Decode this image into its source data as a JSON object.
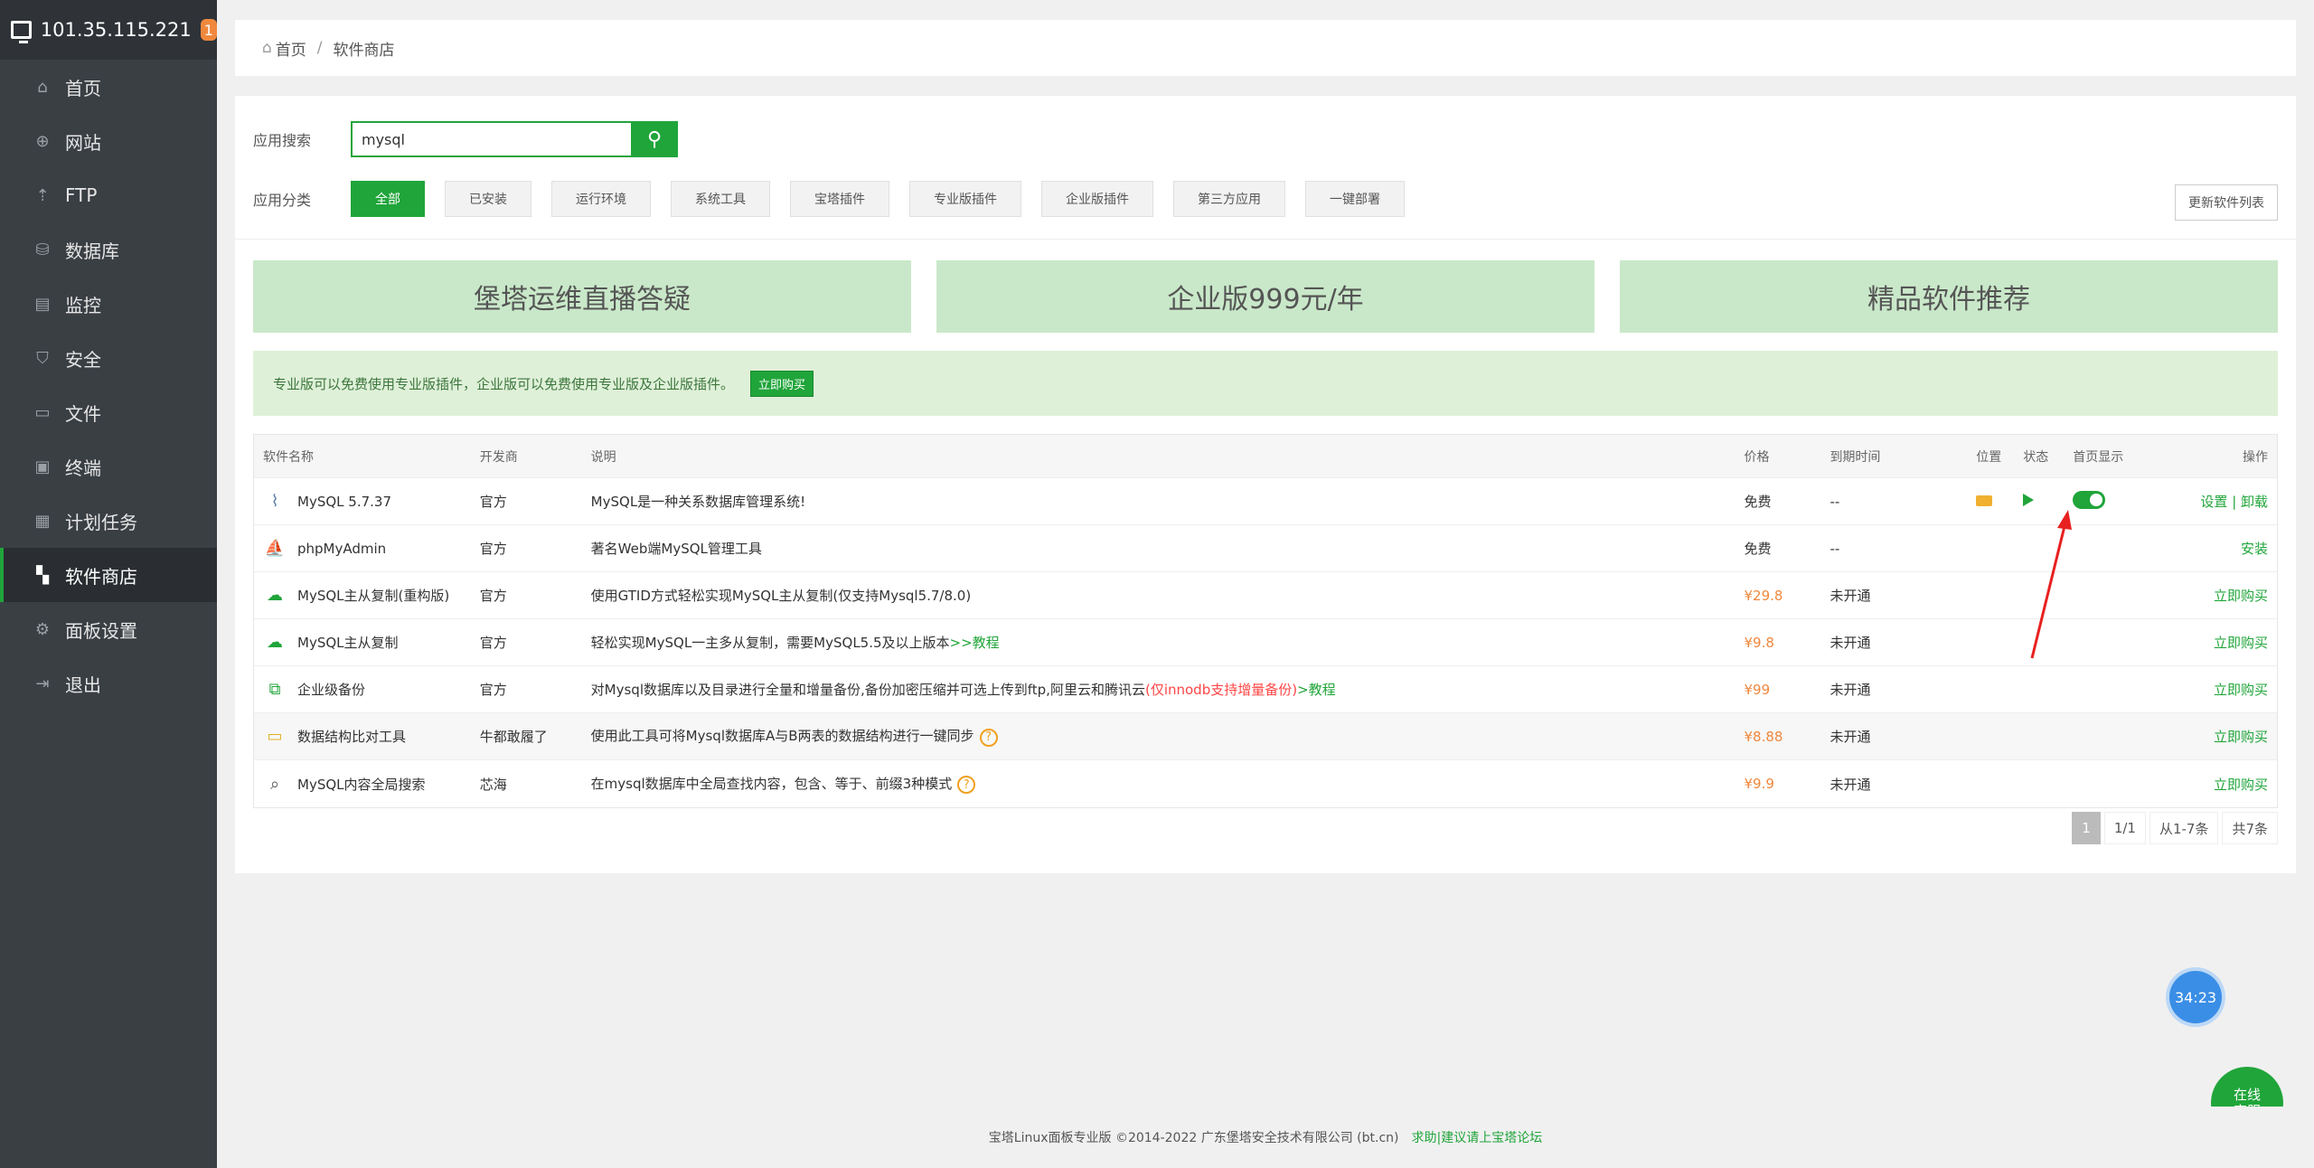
{
  "sidebar": {
    "server_ip": "101.35.115.221",
    "badge": "1",
    "items": [
      {
        "label": "首页",
        "icon": "home-icon",
        "glyph": "⌂"
      },
      {
        "label": "网站",
        "icon": "globe-icon",
        "glyph": "⊕"
      },
      {
        "label": "FTP",
        "icon": "ftp-icon",
        "glyph": "⇡"
      },
      {
        "label": "数据库",
        "icon": "database-icon",
        "glyph": "⛁"
      },
      {
        "label": "监控",
        "icon": "monitor-icon",
        "glyph": "▤"
      },
      {
        "label": "安全",
        "icon": "shield-icon",
        "glyph": "⛉"
      },
      {
        "label": "文件",
        "icon": "folder-icon",
        "glyph": "▭"
      },
      {
        "label": "终端",
        "icon": "terminal-icon",
        "glyph": "▣"
      },
      {
        "label": "计划任务",
        "icon": "calendar-icon",
        "glyph": "▦"
      },
      {
        "label": "软件商店",
        "icon": "grid-icon",
        "glyph": "▚"
      },
      {
        "label": "面板设置",
        "icon": "gear-icon",
        "glyph": "⚙"
      },
      {
        "label": "退出",
        "icon": "logout-icon",
        "glyph": "⇥"
      }
    ]
  },
  "breadcrumb": {
    "home": "首页",
    "sep": "/",
    "current": "软件商店"
  },
  "search": {
    "label": "应用搜索",
    "value": "mysql"
  },
  "categories": {
    "label": "应用分类",
    "items": [
      "全部",
      "已安装",
      "运行环境",
      "系统工具",
      "宝塔插件",
      "专业版插件",
      "企业版插件",
      "第三方应用",
      "一键部署"
    ]
  },
  "update_button": "更新软件列表",
  "banners": [
    "堡塔运维直播答疑",
    "企业版999元/年",
    "精品软件推荐"
  ],
  "notice": {
    "text": "专业版可以免费使用专业版插件，企业版可以免费使用专业版及企业版插件。",
    "buy": "立即购买"
  },
  "table": {
    "headers": [
      "软件名称",
      "开发商",
      "说明",
      "价格",
      "到期时间",
      "位置",
      "状态",
      "首页显示",
      "操作"
    ],
    "rows": [
      {
        "name": "MySQL 5.7.37",
        "dev": "官方",
        "desc": "MySQL是一种关系数据库管理系统!",
        "price": "免费",
        "expire": "--",
        "op": "设置 | 卸载"
      },
      {
        "name": "phpMyAdmin",
        "dev": "官方",
        "desc": "著名Web端MySQL管理工具",
        "price": "免费",
        "expire": "--",
        "op": "安装"
      },
      {
        "name": "MySQL主从复制(重构版)",
        "dev": "官方",
        "desc": "使用GTID方式轻松实现MySQL主从复制(仅支持Mysql5.7/8.0)",
        "price": "¥29.8",
        "expire": "未开通",
        "op": "立即购买"
      },
      {
        "name": "MySQL主从复制",
        "dev": "官方",
        "desc": "轻松实现MySQL一主多从复制，需要MySQL5.5及以上版本",
        "link": ">>教程",
        "price": "¥9.8",
        "expire": "未开通",
        "op": "立即购买"
      },
      {
        "name": "企业级备份",
        "dev": "官方",
        "desc": "对Mysql数据库以及目录进行全量和增量备份,备份加密压缩并可选上传到ftp,阿里云和腾讯云",
        "desc_red": "(仅innodb支持增量备份)",
        "link": ">教程",
        "price": "¥99",
        "expire": "未开通",
        "op": "立即购买"
      },
      {
        "name": "数据结构比对工具",
        "dev": "牛都敢履了",
        "desc": "使用此工具可将Mysql数据库A与B两表的数据结构进行一键同步",
        "price": "¥8.88",
        "expire": "未开通",
        "op": "立即购买"
      },
      {
        "name": "MySQL内容全局搜索",
        "dev": "芯海",
        "desc": "在mysql数据库中全局查找内容，包含、等于、前缀3种模式",
        "price": "¥9.9",
        "expire": "未开通",
        "op": "立即购买"
      }
    ]
  },
  "pager": {
    "current": "1",
    "pages": "1/1",
    "range": "从1-7条",
    "total": "共7条"
  },
  "timer": "34:23",
  "chat": [
    "在线",
    "客服"
  ],
  "footer": {
    "text": "宝塔Linux面板专业版 ©2014-2022 广东堡塔安全技术有限公司 (bt.cn)",
    "link": "求助|建议请上宝塔论坛"
  },
  "colors": {
    "accent": "#20a53a",
    "sidebar": "#3a3f44",
    "price_red": "#f44"
  }
}
